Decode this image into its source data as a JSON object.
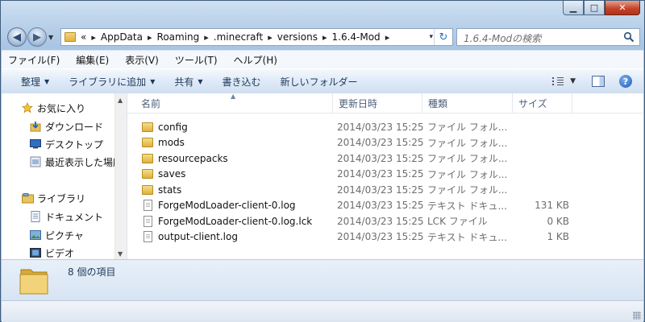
{
  "window": {
    "title_ghost": "",
    "controls": {
      "minimize": "▁",
      "maximize": "□",
      "close": "✕"
    }
  },
  "address": {
    "overflow": "«",
    "crumbs": [
      "AppData",
      "Roaming",
      ".minecraft",
      "versions",
      "1.6.4-Mod"
    ],
    "separator": "▸",
    "dropdown": "▾",
    "refresh": "↻"
  },
  "search": {
    "placeholder": "1.6.4-Modの検索"
  },
  "menu": [
    "ファイル(F)",
    "編集(E)",
    "表示(V)",
    "ツール(T)",
    "ヘルプ(H)"
  ],
  "commands": [
    {
      "label": "整理",
      "dropdown": true
    },
    {
      "label": "ライブラリに追加",
      "dropdown": true
    },
    {
      "label": "共有",
      "dropdown": true
    },
    {
      "label": "書き込む",
      "dropdown": false
    },
    {
      "label": "新しいフォルダー",
      "dropdown": false
    }
  ],
  "nav": {
    "favorites": "お気に入り",
    "favorite_items": [
      "ダウンロード",
      "デスクトップ",
      "最近表示した場所"
    ],
    "libraries": "ライブラリ",
    "library_items": [
      "ドキュメント",
      "ピクチャ",
      "ビデオ"
    ]
  },
  "columns": {
    "name": "名前",
    "date": "更新日時",
    "type": "種類",
    "size": "サイズ"
  },
  "files": [
    {
      "name": "config",
      "date": "2014/03/23 15:25",
      "type": "ファイル フォル...",
      "size": "",
      "kind": "folder"
    },
    {
      "name": "mods",
      "date": "2014/03/23 15:25",
      "type": "ファイル フォル...",
      "size": "",
      "kind": "folder"
    },
    {
      "name": "resourcepacks",
      "date": "2014/03/23 15:25",
      "type": "ファイル フォル...",
      "size": "",
      "kind": "folder"
    },
    {
      "name": "saves",
      "date": "2014/03/23 15:25",
      "type": "ファイル フォル...",
      "size": "",
      "kind": "folder"
    },
    {
      "name": "stats",
      "date": "2014/03/23 15:25",
      "type": "ファイル フォル...",
      "size": "",
      "kind": "folder"
    },
    {
      "name": "ForgeModLoader-client-0.log",
      "date": "2014/03/23 15:25",
      "type": "テキスト ドキュ...",
      "size": "131 KB",
      "kind": "file"
    },
    {
      "name": "ForgeModLoader-client-0.log.lck",
      "date": "2014/03/23 15:25",
      "type": "LCK ファイル",
      "size": "0 KB",
      "kind": "file"
    },
    {
      "name": "output-client.log",
      "date": "2014/03/23 15:25",
      "type": "テキスト ドキュ...",
      "size": "1 KB",
      "kind": "file"
    }
  ],
  "details": {
    "count": "8 個の項目"
  },
  "colors": {
    "folder": "#e0b13a",
    "link_text": "#1e395b",
    "accent": "#2a70b8"
  }
}
